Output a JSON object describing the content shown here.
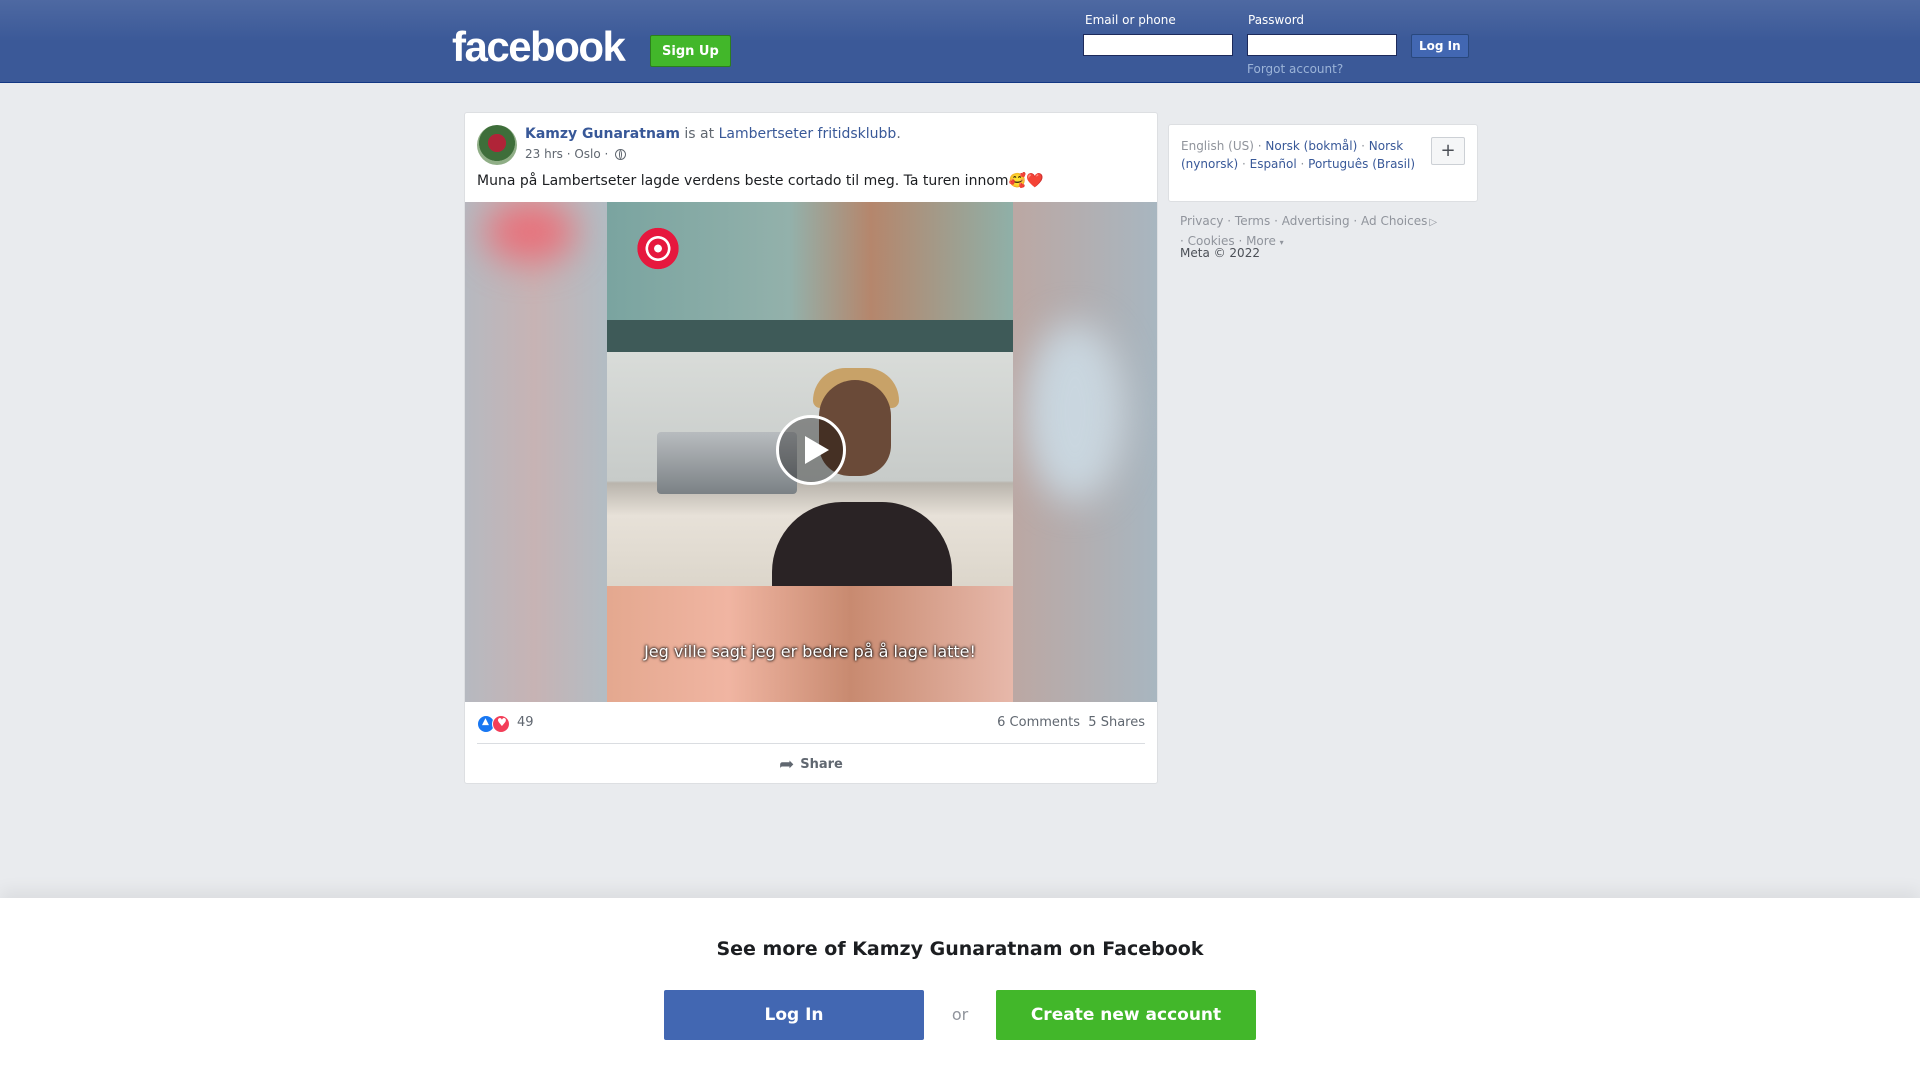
{
  "header": {
    "logo": "facebook",
    "signup_label": "Sign Up",
    "email_label": "Email or phone",
    "email_value": "",
    "password_label": "Password",
    "password_value": "",
    "login_label": "Log In",
    "forgot_label": "Forgot account?"
  },
  "post": {
    "author": "Kamzy Gunaratnam",
    "is_at": " is at ",
    "place": "Lambertseter fritidsklubb",
    "period": ".",
    "time": "23 hrs",
    "location": "Oslo",
    "sep": " · ",
    "text": "Muna på Lambertseter lagde verdens beste cortado til meg. Ta turen innom🥰❤️",
    "video_caption": "Jeg ville sagt jeg er bedre på å lage latte!",
    "reaction_count": "49",
    "comments": "6 Comments",
    "shares": "5 Shares",
    "share_label": "Share"
  },
  "sidebar": {
    "languages": [
      "English (US)",
      "Norsk (bokmål)",
      "Norsk (nynorsk)",
      "Español",
      "Português (Brasil)"
    ],
    "add_language": "+",
    "footer": [
      "Privacy",
      "Terms",
      "Advertising",
      "Ad Choices",
      "Cookies",
      "More"
    ],
    "copyright": "Meta © 2022"
  },
  "bottom_bar": {
    "title": "See more of Kamzy Gunaratnam on Facebook",
    "login_label": "Log In",
    "or_label": "or",
    "create_label": "Create new account"
  },
  "colors": {
    "brand_blue": "#3b5998",
    "green": "#42b72a",
    "link": "#385898"
  }
}
